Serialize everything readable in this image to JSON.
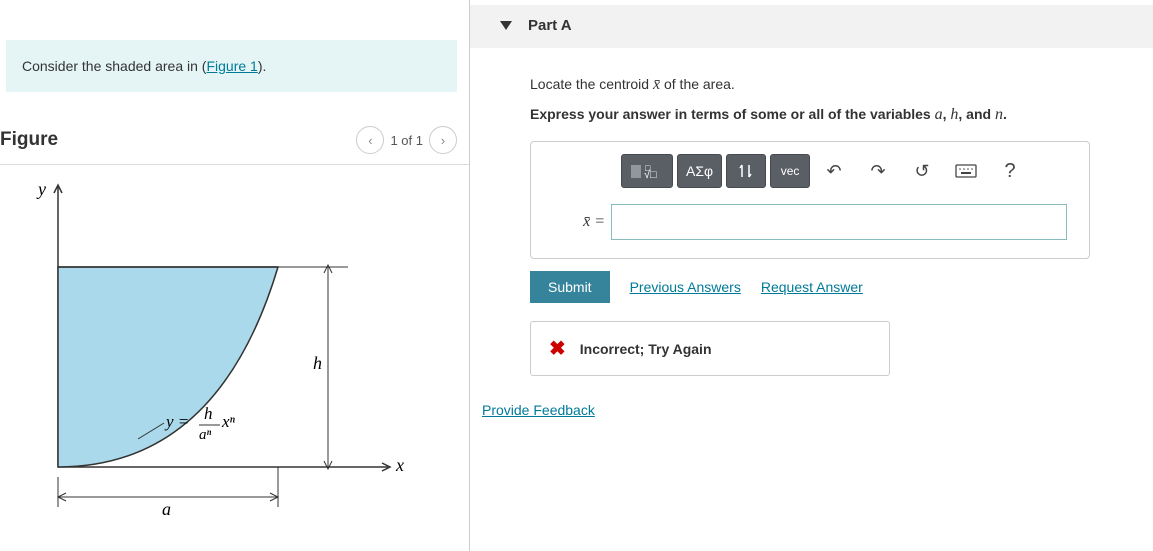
{
  "prompt": {
    "prefix": "Consider the shaded area in (",
    "link": "Figure 1",
    "suffix": ")."
  },
  "figure": {
    "title": "Figure",
    "pager": "1 of 1",
    "labels": {
      "y_axis": "y",
      "x_axis": "x",
      "h": "h",
      "a": "a",
      "eq_lhs": "y = ",
      "eq_num": "h",
      "eq_den": "aⁿ",
      "eq_rhs": " xⁿ"
    }
  },
  "partA": {
    "title": "Part A",
    "q1_prefix": "Locate the centroid ",
    "q1_var": "x̄",
    "q1_suffix": " of the area.",
    "q2_prefix": "Express your answer in terms of some or all of the variables ",
    "q2_v1": "a",
    "q2_c1": ", ",
    "q2_v2": "h",
    "q2_c2": ", and ",
    "q2_v3": "n",
    "q2_c3": ".",
    "toolbar": {
      "greek": "ΑΣφ",
      "vec": "vec",
      "help": "?"
    },
    "eq_label": "x̄ =",
    "submit": "Submit",
    "prev_link": "Previous Answers",
    "req_link": "Request Answer",
    "feedback": "Incorrect; Try Again"
  },
  "provide_feedback": "Provide Feedback"
}
